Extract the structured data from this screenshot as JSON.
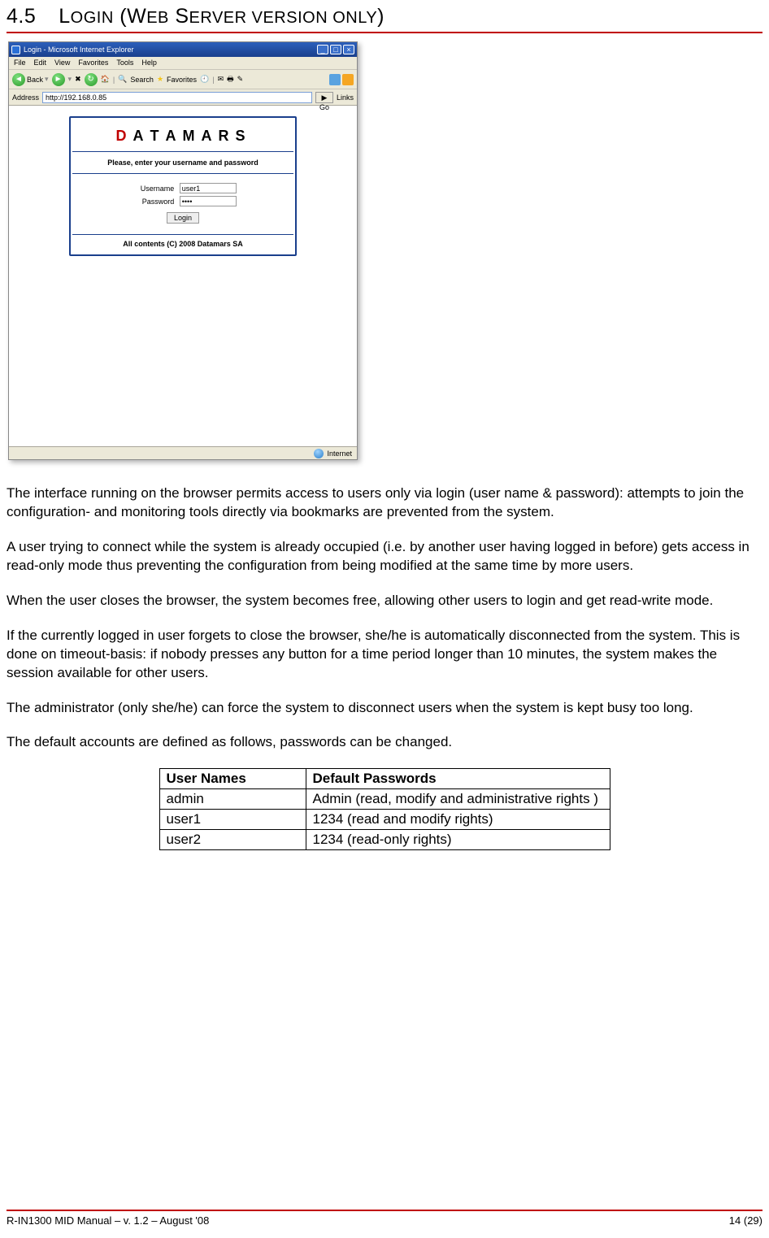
{
  "heading": {
    "number": "4.5",
    "title": "LOGIN (WEB SERVER VERSION ONLY)"
  },
  "browser": {
    "title": "Login - Microsoft Internet Explorer",
    "menu": [
      "File",
      "Edit",
      "View",
      "Favorites",
      "Tools",
      "Help"
    ],
    "toolbar": {
      "back": "Back",
      "search": "Search",
      "favorites": "Favorites"
    },
    "address_label": "Address",
    "address_value": "http://192.168.0.85",
    "go_label": "Go",
    "links_label": "Links",
    "login_page": {
      "logo_letters": [
        "D",
        "A",
        "T",
        "A",
        "M",
        "A",
        "R",
        "S"
      ],
      "prompt": "Please, enter your username and password",
      "username_label": "Username",
      "username_value": "user1",
      "password_label": "Password",
      "password_value": "••••",
      "login_button": "Login",
      "copyright": "All contents (C) 2008 Datamars SA"
    },
    "status": "Internet"
  },
  "paragraphs": {
    "p1": "The interface running on the browser permits access to users only via login (user name & password): attempts to join the configuration- and monitoring tools directly via bookmarks are prevented from the system.",
    "p2": "A user trying to connect while the system is already occupied (i.e. by another user having logged in before) gets access in read-only mode thus preventing the configuration from being modified at the same time by more users.",
    "p3": "When the user closes the browser, the system becomes free, allowing other users to login and get read-write mode.",
    "p4": "If the currently logged in user forgets to close the browser, she/he is automatically disconnected from the system.  This is done on timeout-basis: if nobody presses any button for a time period longer than 10 minutes, the system makes the session available for other users.",
    "p5": "The administrator (only she/he) can force the system to disconnect users when the system is kept busy too long.",
    "p6": "The default accounts are defined as follows, passwords can be changed."
  },
  "table": {
    "headers": {
      "c1": "User Names",
      "c2": "Default Passwords"
    },
    "rows": [
      {
        "c1": "admin",
        "c2": "Admin (read, modify and administrative rights )"
      },
      {
        "c1": "user1",
        "c2": "1234 (read and modify rights)"
      },
      {
        "c1": "user2",
        "c2": "1234 (read-only rights)"
      }
    ]
  },
  "footer": {
    "left": "R-IN1300 MID Manual  – v. 1.2 – August '08",
    "right": "14 (29)"
  }
}
